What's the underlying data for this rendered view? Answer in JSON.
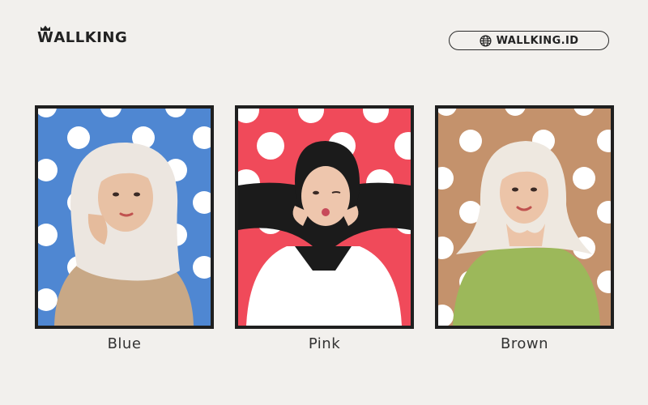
{
  "brand": {
    "name": "WALLKING",
    "logo_w": "W",
    "logo_rest": "ALLKING"
  },
  "website": {
    "label": "WALLKING.ID",
    "icon": "globe-icon"
  },
  "photos": [
    {
      "caption": "Blue",
      "background_color": "#4f87d2",
      "hijab_color": "#ece6e0",
      "top_color": "#c8a886"
    },
    {
      "caption": "Pink",
      "background_color": "#f04a5a",
      "hijab_color": "#1b1b1b",
      "top_color": "#ffffff"
    },
    {
      "caption": "Brown",
      "background_color": "#c4926c",
      "hijab_color": "#eee8e0",
      "top_color": "#9cb85a"
    }
  ],
  "colors": {
    "page_background": "#f2f0ed",
    "frame": "#1f1f1f",
    "dots": "#ffffff"
  }
}
